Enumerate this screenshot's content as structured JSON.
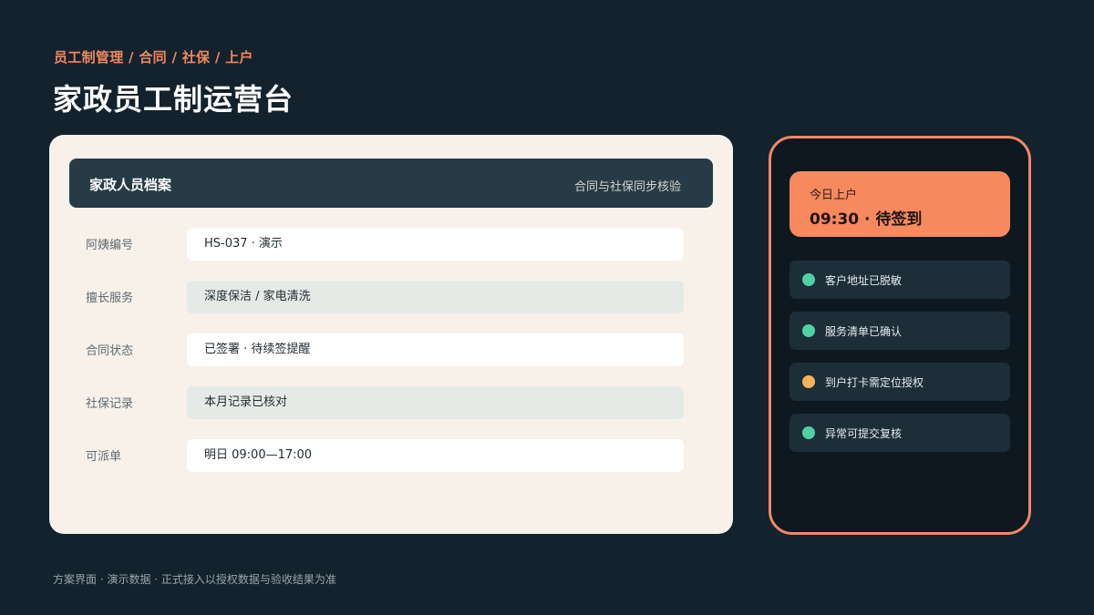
{
  "header": {
    "breadcrumb": "员工制管理 / 合同 / 社保 / 上户",
    "title": "家政员工制运营台"
  },
  "profile": {
    "title": "家政人员档案",
    "subtitle": "合同与社保同步核验",
    "fields": [
      {
        "label": "阿姨编号",
        "value": "HS-037 · 演示"
      },
      {
        "label": "擅长服务",
        "value": "深度保洁 / 家电清洗"
      },
      {
        "label": "合同状态",
        "value": "已签署 · 待续签提醒"
      },
      {
        "label": "社保记录",
        "value": "本月记录已核对"
      },
      {
        "label": "可派单",
        "value": "明日 09:00—17:00"
      }
    ]
  },
  "mobile": {
    "checkin": {
      "label": "今日上户",
      "value": "09:30 · 待签到"
    },
    "status_items": [
      {
        "text": "客户地址已脱敏",
        "color": "#4fd1a1"
      },
      {
        "text": "服务清单已确认",
        "color": "#4fd1a1"
      },
      {
        "text": "到户打卡需定位授权",
        "color": "#f6b35a"
      },
      {
        "text": "异常可提交复核",
        "color": "#4fd1a1"
      }
    ]
  },
  "footer": {
    "note": "方案界面 · 演示数据 · 正式接入以授权数据与验收结果为准"
  }
}
